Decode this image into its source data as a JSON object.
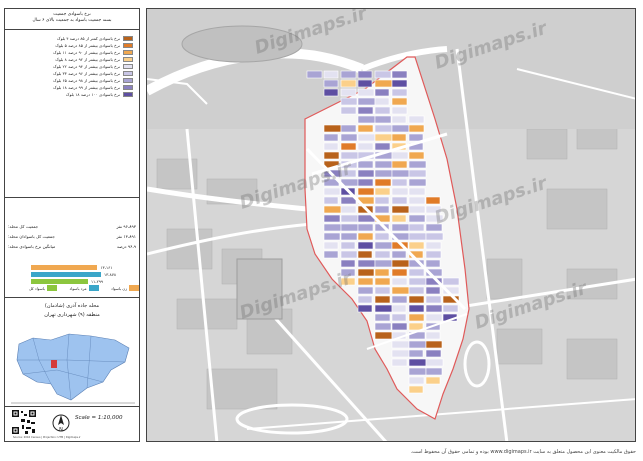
{
  "legend": {
    "title_line1": "نرخ باسوادی جمعیت",
    "title_line2": "بسته جمعیت باسواد به جمعیت بالای ۶ سال",
    "items": [
      {
        "label": "نرخ باسوادی کمتر از ۸۵ درصد ۴ بلوک",
        "color": "#b8621b"
      },
      {
        "label": "نرخ باسوادی بیشتر از ۸۵ درصد ۵ بلوک",
        "color": "#e07b28"
      },
      {
        "label": "نرخ باسوادی بیشتر از ۹۰ درصد ۱۱ بلوک",
        "color": "#f0a850"
      },
      {
        "label": "نرخ باسوادی بیشتر از ۹۲ درصد ۸ بلوک",
        "color": "#fbd08a"
      },
      {
        "label": "نرخ باسوادی بیشتر از ۹۴ درصد ۲۲ بلوک",
        "color": "#e3e2f1"
      },
      {
        "label": "نرخ باسوادی بیشتر از ۹۶ درصد ۳۳ بلوک",
        "color": "#c9c6e6"
      },
      {
        "label": "نرخ باسوادی بیشتر از ۹۸ درصد ۶۵ بلوک",
        "color": "#a9a4d4"
      },
      {
        "label": "نرخ باسوادی بیشتر از ۹۹ درصد ۱۸ بلوک",
        "color": "#8a80c0"
      },
      {
        "label": "نرخ باسوادی ۱۰۰ درصد ۱۸ بلوک",
        "color": "#5e4fa2"
      }
    ]
  },
  "stats": {
    "rows": [
      {
        "label": "جمعیت کل محله:",
        "value": "۹۶،۸۹۳ نفر"
      },
      {
        "label": "جمعیت کل باسوادان محله:",
        "value": "۱۳،۸۹۱ نفر"
      },
      {
        "label": "میانگین نرخ باسوادی محله:",
        "value": "۹۶،۹ درصد"
      }
    ]
  },
  "bars": [
    {
      "label": "۱۳،۱۶۱",
      "value": 13161,
      "color": "#f0a850"
    },
    {
      "label": "۱۳،۸۷۸",
      "value": 13878,
      "color": "#3aa6c9"
    },
    {
      "label": "۱۱،۲۹۹",
      "value": 11299,
      "color": "#8cc63e"
    }
  ],
  "bar_legend": [
    {
      "label": "باسواد کل",
      "color": "#8cc63e"
    },
    {
      "label": "مرد باسواد",
      "color": "#3aa6c9"
    },
    {
      "label": "زن باسواد",
      "color": "#f0a850"
    }
  ],
  "area": {
    "line1": "محله جاده آذری (شادمان)",
    "line2": "منطقه (۹) شهرداری تهران"
  },
  "scale": "Scale = 1:10,000",
  "credits": "Source: 2016 Census  |  Projection: UTM  |  Digimaps.ir",
  "watermark": "Digimaps.ir",
  "footer": "حقوق مالکیت معنوی این محصول متعلق به سایت www.digimaps.ir بوده و تمامی حقوق آن محفوظ است.",
  "colors": {
    "boundary": "#e05a5a",
    "inset_fill": "#9ec3ef",
    "inset_highlight": "#d43a3a"
  }
}
